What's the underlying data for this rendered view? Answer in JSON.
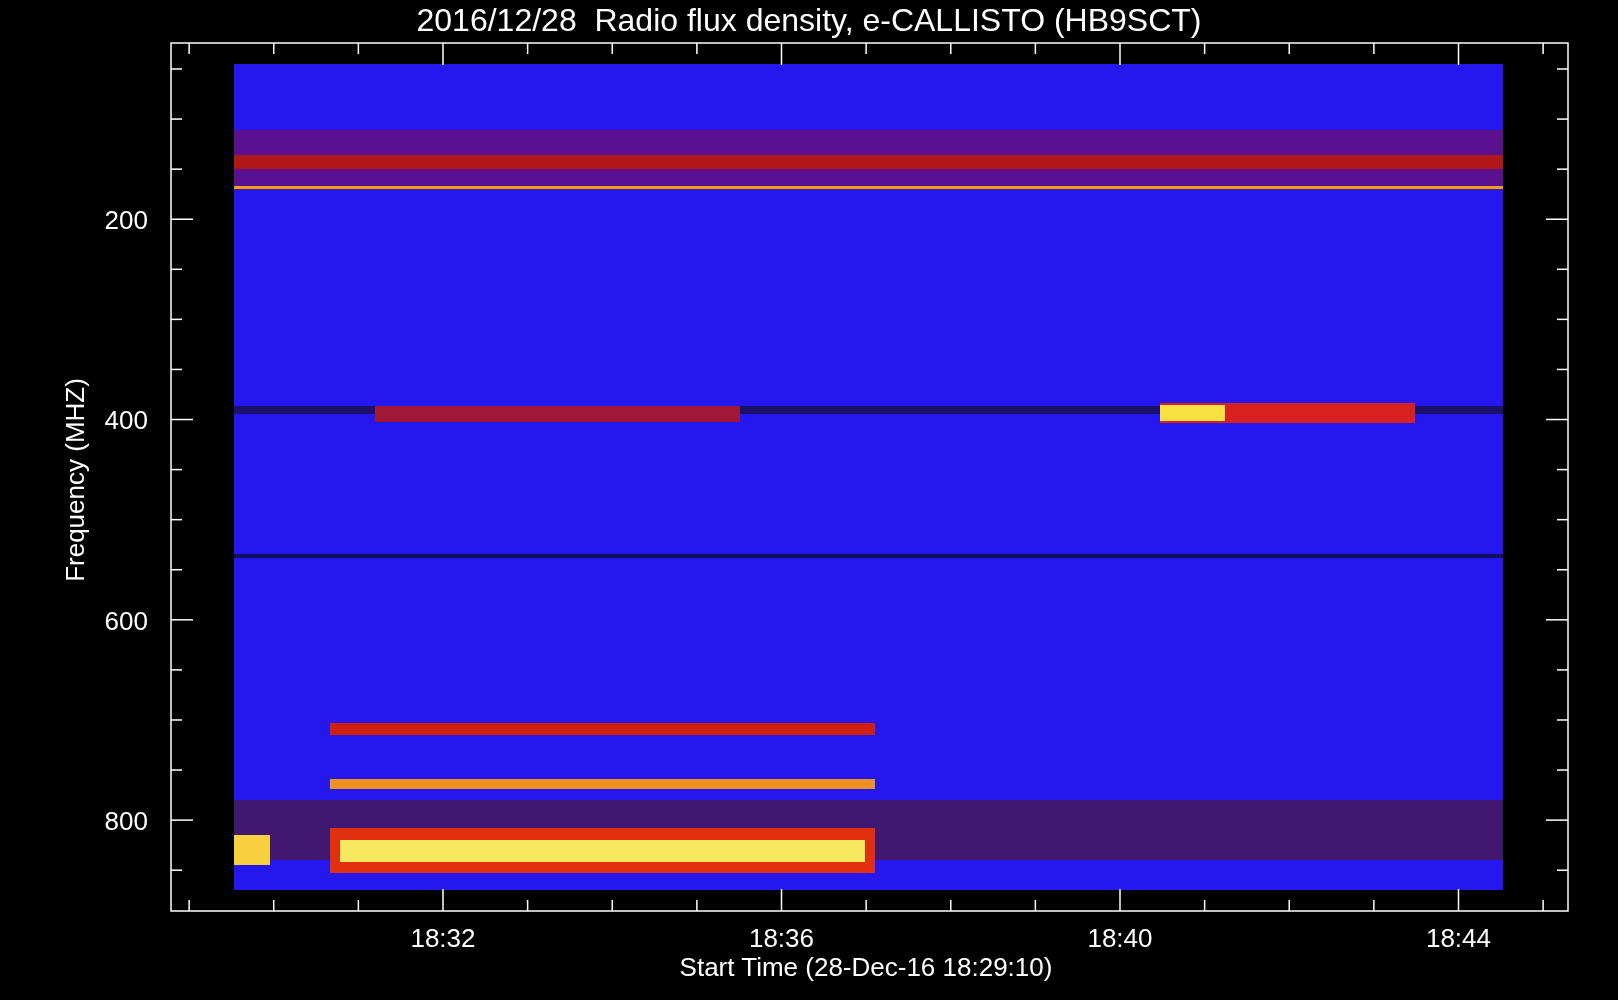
{
  "title": "2016/12/28  Radio flux density, e-CALLISTO (HB9SCT)",
  "y_axis": {
    "label": "Frequency (MHZ)",
    "ticks": [
      "200",
      "400",
      "600",
      "800"
    ]
  },
  "x_axis": {
    "label": "Start Time (28-Dec-16 18:29:10)",
    "ticks": [
      "18:32",
      "18:36",
      "18:40",
      "18:44"
    ]
  }
}
